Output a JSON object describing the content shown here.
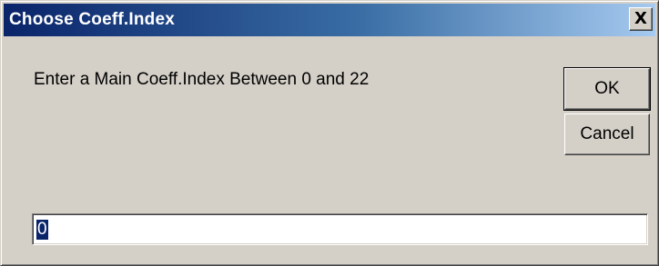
{
  "window": {
    "title": "Choose Coeff.Index",
    "close_glyph": "X"
  },
  "prompt": {
    "text": "Enter a Main Coeff.Index Between 0 and 22"
  },
  "buttons": {
    "ok_label": "OK",
    "cancel_label": "Cancel"
  },
  "input": {
    "value": "0"
  },
  "colors": {
    "title_bar_start": "#0a246a",
    "title_bar_end": "#a6caf0",
    "dialog_bg": "#d4d0c8",
    "selection": "#0a246a"
  }
}
